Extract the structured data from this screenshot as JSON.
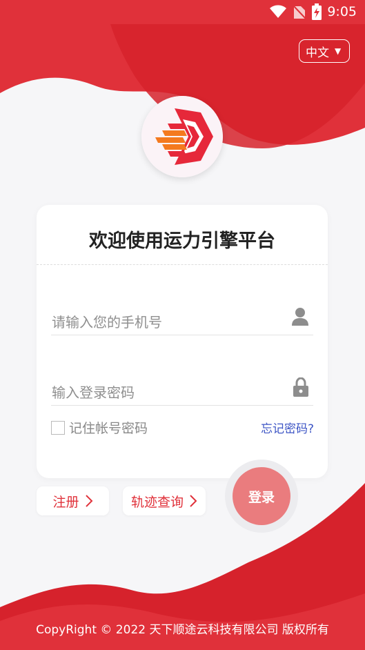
{
  "status_bar": {
    "time": "9:05"
  },
  "header": {
    "language": "中文"
  },
  "card": {
    "title": "欢迎使用运力引擎平台",
    "phone_placeholder": "请输入您的手机号",
    "password_placeholder": "输入登录密码",
    "remember_label": "记住帐号密码",
    "forgot_label": "忘记密码?"
  },
  "actions": {
    "register_label": "注册",
    "track_label": "轨迹查询",
    "login_label": "登录"
  },
  "footer": {
    "copyright": "CopyRight © 2022 天下顺途云科技有限公司 版权所有"
  },
  "colors": {
    "brand_red": "#e0313a",
    "login_button": "#ea7c7e",
    "link_blue": "#3d55c5"
  },
  "icons": [
    "wifi-icon",
    "no-sim-icon",
    "battery-charging-icon",
    "chevron-down-icon",
    "user-icon",
    "lock-icon",
    "chevron-right-icon",
    "logo-icon"
  ]
}
